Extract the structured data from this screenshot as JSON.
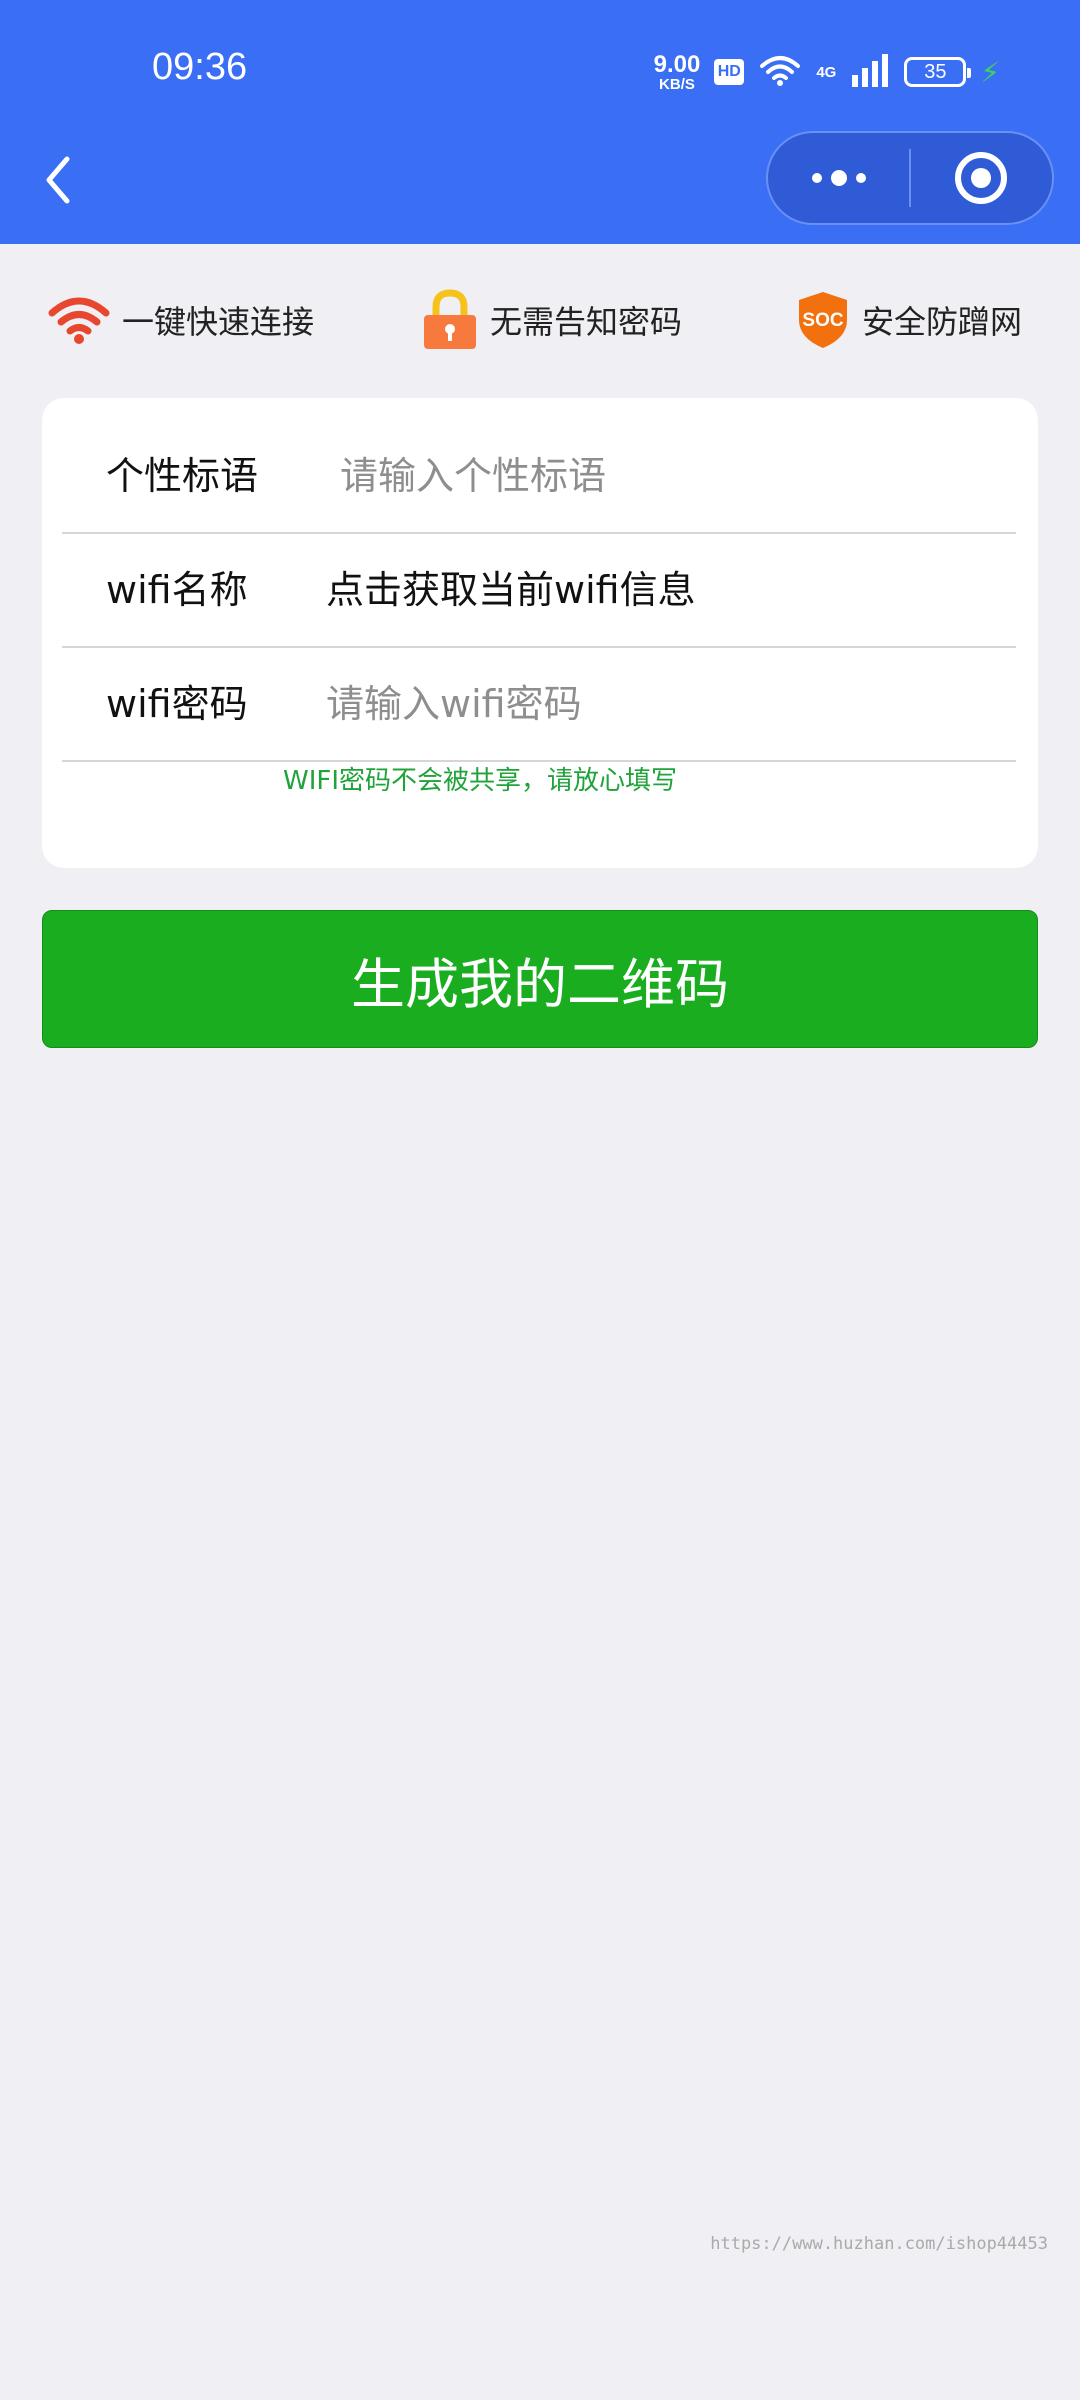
{
  "status_bar": {
    "time": "09:36",
    "net_speed_value": "9.00",
    "net_speed_unit": "KB/S",
    "hd_badge": "HD",
    "network_type": "4G",
    "battery_level": "35"
  },
  "nav": {
    "back_icon": "chevron-left-icon",
    "menu_icon": "more-dots-icon",
    "close_icon": "target-circle-icon"
  },
  "features": [
    {
      "icon": "wifi-icon",
      "label": "一键快速连接"
    },
    {
      "icon": "lock-icon",
      "label": "无需告知密码"
    },
    {
      "icon": "soc-shield-icon",
      "icon_text": "SOC",
      "label": "安全防蹭网"
    }
  ],
  "form": {
    "slogan": {
      "label": "个性标语",
      "placeholder": "请输入个性标语"
    },
    "wifi_name": {
      "label": "wifi名称",
      "value": "点击获取当前wifi信息"
    },
    "wifi_password": {
      "label": "wifi密码",
      "placeholder": "请输入wifi密码"
    },
    "hint": "WIFI密码不会被共享，请放心填写"
  },
  "generate_button": "生成我的二维码",
  "watermark": "https://www.huzhan.com/ishop44453",
  "colors": {
    "header_blue": "#3a6ef5",
    "button_green": "#1aad1f",
    "hint_green": "#20a33a",
    "wifi_red": "#e8472f",
    "lock_orange": "#f7793e",
    "soc_orange": "#f2700e"
  }
}
